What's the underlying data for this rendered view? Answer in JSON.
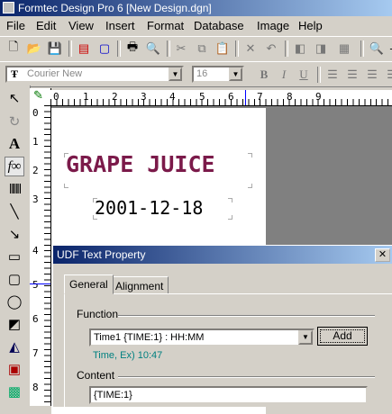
{
  "window": {
    "title": "Formtec Design Pro 6 [New Design.dgn]"
  },
  "menu": [
    "File",
    "Edit",
    "View",
    "Insert",
    "Format",
    "Database",
    "Image",
    "Help"
  ],
  "format_bar": {
    "font": "Courier New",
    "size": "16"
  },
  "hruler_labels": [
    "0",
    "1",
    "2",
    "3",
    "4",
    "5",
    "6",
    "7",
    "8",
    "9"
  ],
  "vruler_labels": [
    "0",
    "1",
    "2",
    "3",
    "4",
    "5",
    "6",
    "7",
    "8"
  ],
  "canvas": {
    "title_text": "GRAPE JUICE",
    "date_text": "2001-12-18",
    "title_color": "#7b1a4a"
  },
  "dialog": {
    "title": "UDF Text Property",
    "tabs": [
      "General",
      "Alignment"
    ],
    "function_label": "Function",
    "function_value": "Time1    {TIME:1} : HH:MM",
    "add_label": "Add",
    "example": "Time, Ex) 10:47",
    "content_label": "Content",
    "content_value": "{TIME:1}"
  },
  "colors": {
    "title_bar": "#0a246a",
    "example_text": "#008080"
  }
}
